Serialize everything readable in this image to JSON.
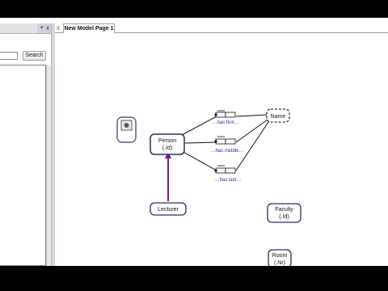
{
  "panel": {
    "pin_glyph": "ᵠ",
    "close_glyph": "x",
    "search_value": "",
    "search_button_label": "Search"
  },
  "tabs": [
    {
      "label": "New Model Page 1",
      "active": true
    }
  ],
  "tab_close_glyph": "x",
  "diagram": {
    "nodes": {
      "person": {
        "name": "Person",
        "ref": "(.Id)"
      },
      "name": {
        "name": "Name"
      },
      "lecturer": {
        "name": "Lecturer"
      },
      "faculty": {
        "name": "Faculty",
        "ref": "(.Id)"
      },
      "room": {
        "name": "Room",
        "ref": "(.Nr)"
      }
    },
    "facts": [
      {
        "reading": "…has first…"
      },
      {
        "reading": "…has middle…"
      },
      {
        "reading": "…has last…"
      }
    ],
    "colors": {
      "entity_border": "#2d2a6e",
      "subtype_arrow": "#7a1a7a",
      "reading_text": "#2a2aa8",
      "connector": "#111111"
    }
  }
}
